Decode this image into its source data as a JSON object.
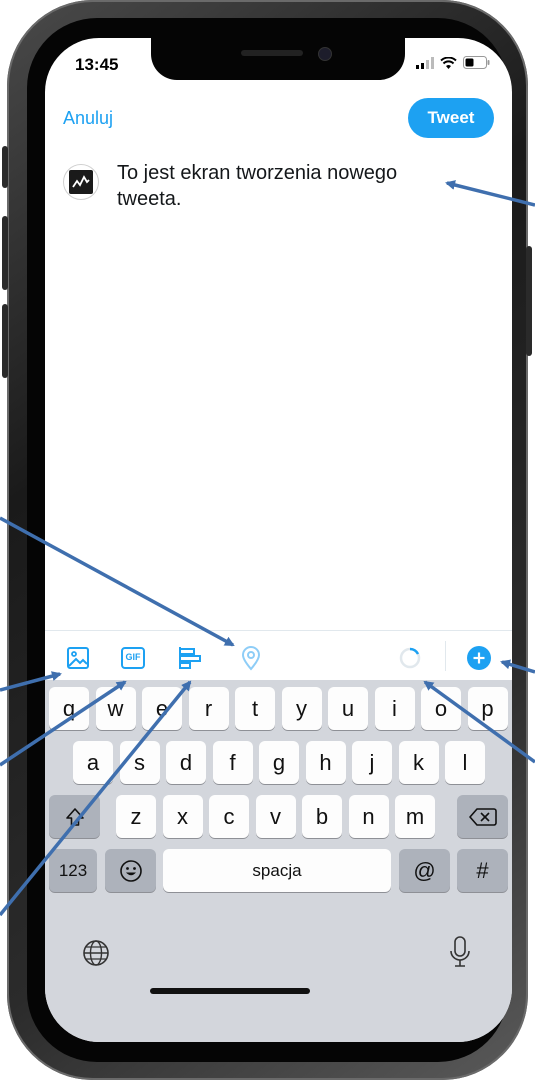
{
  "status_bar": {
    "time": "13:45"
  },
  "header": {
    "cancel_label": "Anuluj",
    "tweet_label": "Tweet"
  },
  "compose": {
    "text": "To jest ekran tworzenia nowego tweeta."
  },
  "toolbar": {
    "icons": [
      "image-icon",
      "gif-icon",
      "poll-icon",
      "location-icon",
      "progress-ring-icon",
      "add-thread-icon"
    ],
    "gif_glyph": "GIF"
  },
  "keyboard": {
    "row1": [
      "q",
      "w",
      "e",
      "r",
      "t",
      "y",
      "u",
      "i",
      "o",
      "p"
    ],
    "row2": [
      "a",
      "s",
      "d",
      "f",
      "g",
      "h",
      "j",
      "k",
      "l"
    ],
    "row3": [
      "z",
      "x",
      "c",
      "v",
      "b",
      "n",
      "m"
    ],
    "numbers_label": "123",
    "space_label": "spacja",
    "at_label": "@",
    "hash_label": "#"
  },
  "colors": {
    "accent": "#1da1f2",
    "arrow": "#3f6fae",
    "keyboard_bg": "#d3d6dc"
  }
}
